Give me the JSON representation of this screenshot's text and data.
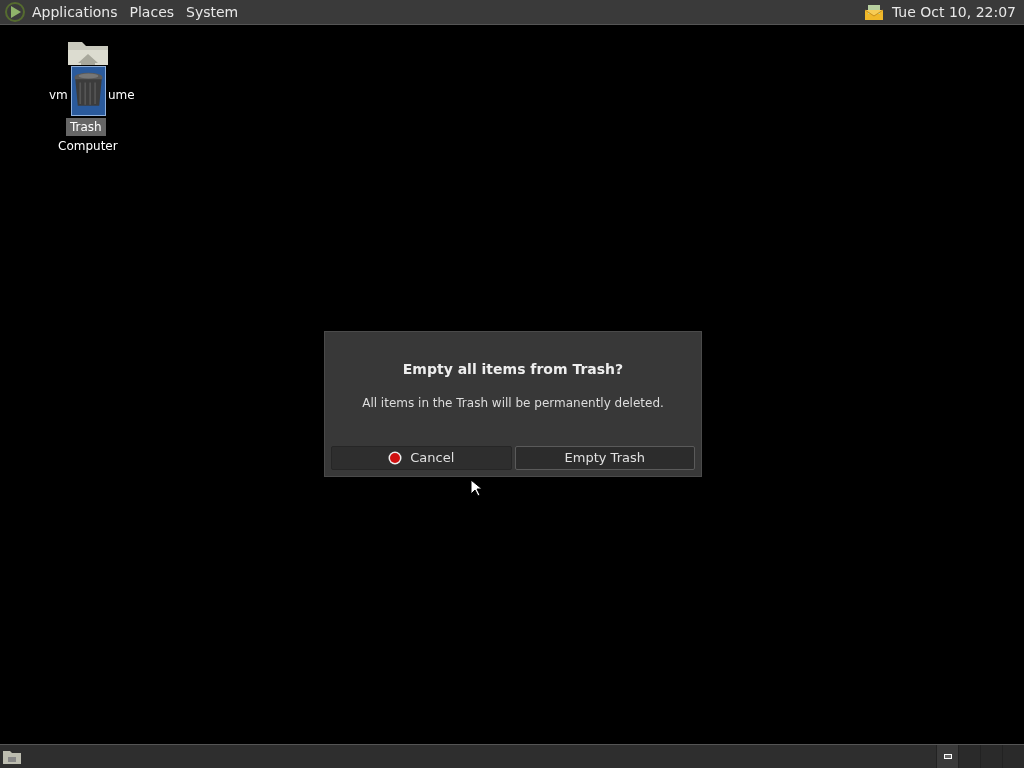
{
  "top_panel": {
    "menus": [
      "Applications",
      "Places",
      "System"
    ],
    "clock": "Tue Oct 10, 22:07"
  },
  "desktop_icons": [
    {
      "kind": "folder",
      "label_parts": [
        "vm",
        "ume"
      ],
      "selected": false
    },
    {
      "kind": "trash",
      "label": "Trash",
      "selected": true
    },
    {
      "kind": "computer",
      "label": "Computer",
      "selected": false
    }
  ],
  "dialog": {
    "title": "Empty all items from Trash?",
    "message": "All items in the Trash will be permanently deleted.",
    "buttons": [
      {
        "kind": "cancel",
        "label": "Cancel"
      },
      {
        "kind": "default",
        "label": "Empty Trash"
      }
    ]
  },
  "bottom_panel": {
    "workspaces": [
      {
        "selected": true
      },
      {
        "selected": false
      },
      {
        "selected": false
      },
      {
        "selected": false
      }
    ]
  }
}
